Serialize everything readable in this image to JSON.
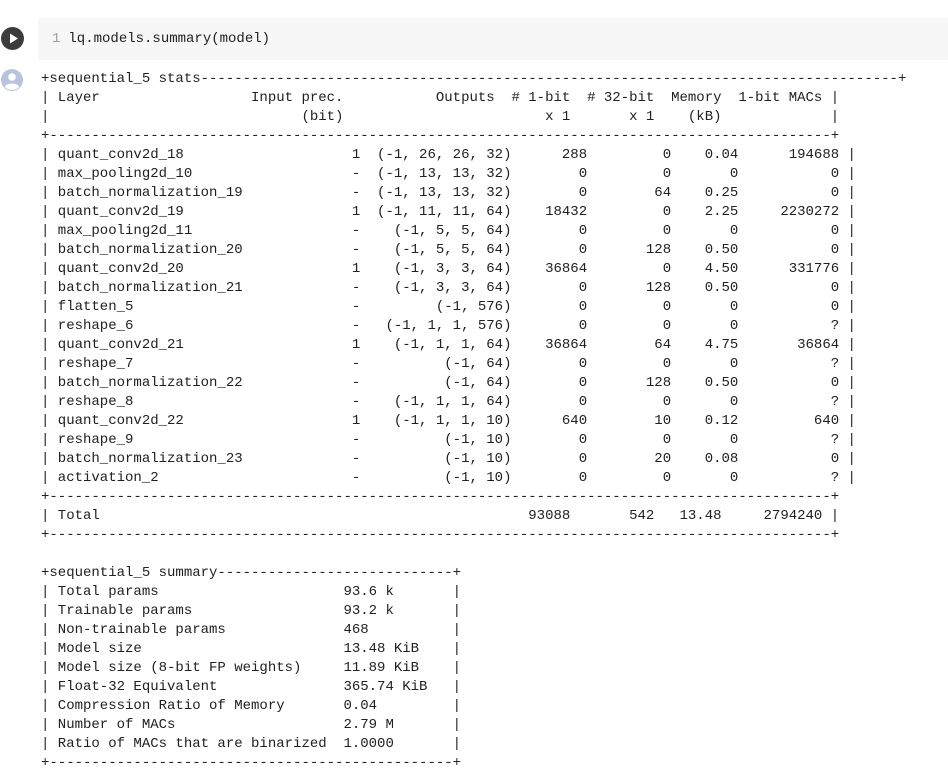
{
  "code_cell": {
    "line_number": "1",
    "code": "lq.models.summary(model)"
  },
  "output": {
    "stats_header": "+sequential_5 stats-----------------------------------------------------------------------------------+",
    "stats_cols_1": "| Layer                  Input prec.           Outputs  # 1-bit  # 32-bit  Memory  1-bit MACs |",
    "stats_cols_2": "|                              (bit)                        x 1       x 1    (kB)             |",
    "stats_sep": "+---------------------------------------------------------------------------------------------+",
    "stats_rows": [
      "| quant_conv2d_18                    1  (-1, 26, 26, 32)      288         0    0.04      194688 |",
      "| max_pooling2d_10                   -  (-1, 13, 13, 32)        0         0       0           0 |",
      "| batch_normalization_19             -  (-1, 13, 13, 32)        0        64    0.25           0 |",
      "| quant_conv2d_19                    1  (-1, 11, 11, 64)    18432         0    2.25     2230272 |",
      "| max_pooling2d_11                   -    (-1, 5, 5, 64)        0         0       0           0 |",
      "| batch_normalization_20             -    (-1, 5, 5, 64)        0       128    0.50           0 |",
      "| quant_conv2d_20                    1    (-1, 3, 3, 64)    36864         0    4.50      331776 |",
      "| batch_normalization_21             -    (-1, 3, 3, 64)        0       128    0.50           0 |",
      "| flatten_5                          -         (-1, 576)        0         0       0           0 |",
      "| reshape_6                          -   (-1, 1, 1, 576)        0         0       0           ? |",
      "| quant_conv2d_21                    1    (-1, 1, 1, 64)    36864        64    4.75       36864 |",
      "| reshape_7                          -          (-1, 64)        0         0       0           ? |",
      "| batch_normalization_22             -          (-1, 64)        0       128    0.50           0 |",
      "| reshape_8                          -    (-1, 1, 1, 64)        0         0       0           ? |",
      "| quant_conv2d_22                    1    (-1, 1, 1, 10)      640        10    0.12         640 |",
      "| reshape_9                          -          (-1, 10)        0         0       0           ? |",
      "| batch_normalization_23             -          (-1, 10)        0        20    0.08           0 |",
      "| activation_2                       -          (-1, 10)        0         0       0           ? |"
    ],
    "stats_total": "| Total                                                   93088       542   13.48     2794240 |",
    "summary_header": "+sequential_5 summary----------------------------+",
    "summary_rows": [
      "| Total params                      93.6 k       |",
      "| Trainable params                  93.2 k       |",
      "| Non-trainable params              468          |",
      "| Model size                        13.48 KiB    |",
      "| Model size (8-bit FP weights)     11.89 KiB    |",
      "| Float-32 Equivalent               365.74 KiB   |",
      "| Compression Ratio of Memory       0.04         |",
      "| Number of MACs                    2.79 M       |",
      "| Ratio of MACs that are binarized  1.0000       |"
    ],
    "summary_footer": "+------------------------------------------------+"
  }
}
